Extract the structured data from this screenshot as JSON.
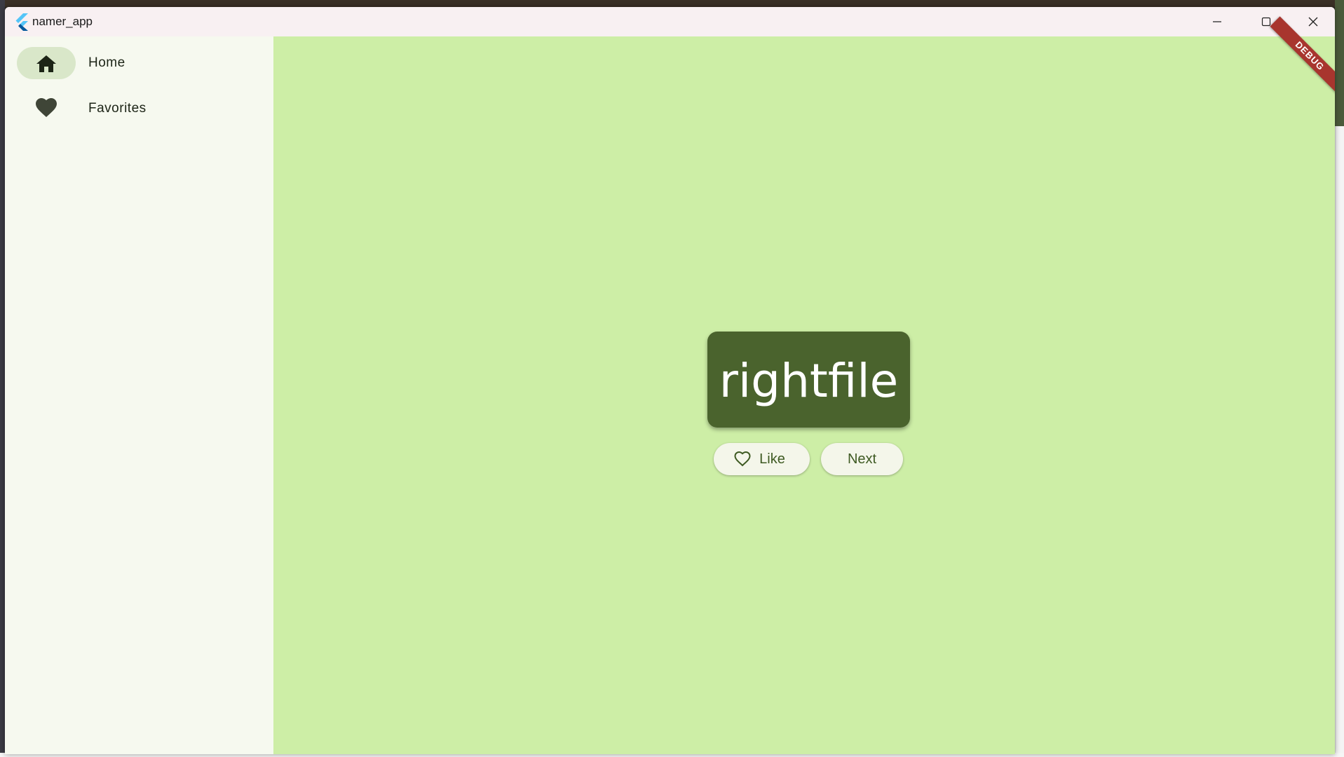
{
  "window": {
    "title": "namer_app"
  },
  "nav": {
    "items": [
      {
        "label": "Home",
        "icon": "home-icon",
        "selected": true
      },
      {
        "label": "Favorites",
        "icon": "heart-icon",
        "selected": false
      }
    ]
  },
  "main": {
    "debug_banner": "DEBUG",
    "word": "rightfile",
    "buttons": {
      "like_label": "Like",
      "next_label": "Next"
    }
  },
  "colors": {
    "main_bg": "#cdeea6",
    "card_bg": "#4a632d",
    "nav_bg": "#f6f9ef",
    "nav_indicator": "#d9e7c9",
    "button_text": "#3e5a22"
  }
}
